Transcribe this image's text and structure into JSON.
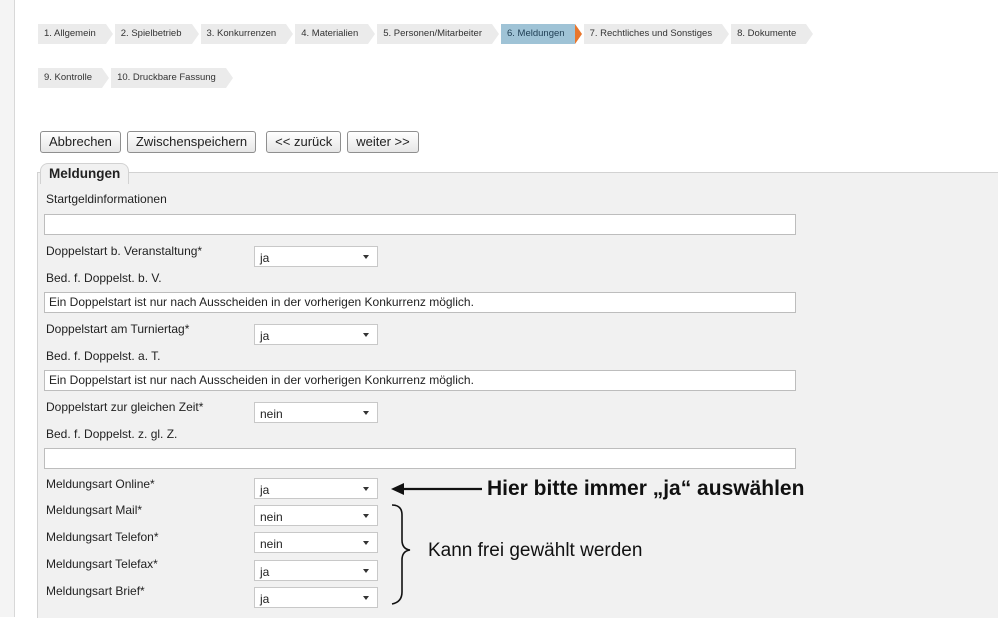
{
  "wizard": {
    "tabs_row1": [
      {
        "label": "1. Allgemein",
        "active": false
      },
      {
        "label": "2. Spielbetrieb",
        "active": false
      },
      {
        "label": "3. Konkurrenzen",
        "active": false
      },
      {
        "label": "4. Materialien",
        "active": false
      },
      {
        "label": "5. Personen/Mitarbeiter",
        "active": false
      },
      {
        "label": "6. Meldungen",
        "active": true
      },
      {
        "label": "7. Rechtliches und Sonstiges",
        "active": false
      },
      {
        "label": "8. Dokumente",
        "active": false
      }
    ],
    "tabs_row2": [
      {
        "label": "9. Kontrolle",
        "active": false
      },
      {
        "label": "10. Druckbare Fassung",
        "active": false
      }
    ]
  },
  "buttons": {
    "cancel": "Abbrechen",
    "save_draft": "Zwischenspeichern",
    "back": "<< zurück",
    "next": "weiter >>"
  },
  "section": {
    "legend": "Meldungen",
    "startgeld_label": "Startgeldinformationen",
    "startgeld_value": "",
    "doppelstart_veranstaltung_label": "Doppelstart b. Veranstaltung*",
    "doppelstart_veranstaltung_value": "ja",
    "bed_veranstaltung_label": "Bed. f. Doppelst. b. V.",
    "bed_veranstaltung_value": "Ein Doppelstart ist nur nach Ausscheiden in der vorherigen Konkurrenz möglich.",
    "doppelstart_turniertag_label": "Doppelstart am Turniertag*",
    "doppelstart_turniertag_value": "ja",
    "bed_turniertag_label": "Bed. f. Doppelst. a. T.",
    "bed_turniertag_value": "Ein Doppelstart ist nur nach Ausscheiden in der vorherigen Konkurrenz möglich.",
    "doppelstart_zeit_label": "Doppelstart zur gleichen Zeit*",
    "doppelstart_zeit_value": "nein",
    "bed_zeit_label": "Bed. f. Doppelst. z. gl. Z.",
    "bed_zeit_value": "",
    "meldungsart": [
      {
        "label": "Meldungsart Online*",
        "value": "ja"
      },
      {
        "label": "Meldungsart Mail*",
        "value": "nein"
      },
      {
        "label": "Meldungsart Telefon*",
        "value": "nein"
      },
      {
        "label": "Meldungsart Telefax*",
        "value": "ja"
      },
      {
        "label": "Meldungsart Brief*",
        "value": "ja"
      }
    ]
  },
  "annotations": {
    "online_hint": "Hier bitte immer „ja“ auswählen",
    "free_choice_hint": "Kann frei gewählt werden"
  },
  "colors": {
    "active_tab": "#9fc3d6",
    "active_tab_marker": "#e8762c",
    "panel_background": "#f1f1f1"
  }
}
